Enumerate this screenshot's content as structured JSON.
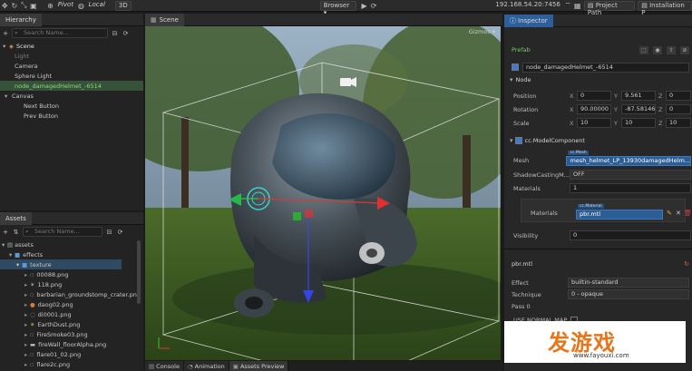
{
  "toolbar": {
    "pivot": "Pivot",
    "local": "Local",
    "mode_3d": "3D",
    "browser": "Browser",
    "ip": "192.168.54.20:7456",
    "project_path": "Project Path",
    "installation_path": "Installation P"
  },
  "hierarchy": {
    "title": "Hierarchy",
    "search_placeholder": "Search Name...",
    "items": [
      {
        "label": "Scene"
      },
      {
        "label": "Light"
      },
      {
        "label": "Camera"
      },
      {
        "label": "Sphere Light"
      },
      {
        "label": "node_damagedHelmet_-6514"
      },
      {
        "label": "Canvas"
      },
      {
        "label": "Next Button"
      },
      {
        "label": "Prev Button"
      }
    ]
  },
  "assets": {
    "title": "Assets",
    "search_placeholder": "Search Name...",
    "items": [
      {
        "label": "assets"
      },
      {
        "label": "effects"
      },
      {
        "label": "texture"
      },
      {
        "label": "00088.png"
      },
      {
        "label": "118.png"
      },
      {
        "label": "barbarian_groundstomp_crater.png"
      },
      {
        "label": "daog02.png"
      },
      {
        "label": "di0001.png"
      },
      {
        "label": "EarthDust.png"
      },
      {
        "label": "FireSmoke03.png"
      },
      {
        "label": "fireWall_floorAlpha.png"
      },
      {
        "label": "flare01_02.png"
      },
      {
        "label": "flare2c.png"
      }
    ]
  },
  "scene": {
    "title": "Scene",
    "gizmos": "Gizmos"
  },
  "bottom_tabs": [
    "Console",
    "Animation",
    "Assets Preview"
  ],
  "inspector": {
    "title": "Inspector",
    "prefab": "Prefab",
    "node_name": "node_damagedHelmet_-6514",
    "node_section": "Node",
    "position": {
      "label": "Position",
      "x": "0",
      "y": "9.561",
      "z": "0"
    },
    "rotation": {
      "label": "Rotation",
      "x": "90.00000",
      "y": "-87.58146",
      "z": "0"
    },
    "scale": {
      "label": "Scale",
      "x": "10",
      "y": "10",
      "z": "10"
    },
    "component": "cc.ModelComponent",
    "mesh_label": "Mesh",
    "mesh_tag": "cc.Mesh",
    "mesh_value": "mesh_helmet_LP_13930damagedHelm...",
    "shadow_label": "ShadowCastingM...",
    "shadow_value": "OFF",
    "materials_label": "Materials",
    "materials_count": "1",
    "materials_sub_label": "Materials",
    "material_tag": "cc.Material",
    "material_value": "pbr.mtl",
    "visibility_label": "Visibility",
    "visibility_value": "0",
    "material_file": "pbr.mtl",
    "effect_label": "Effect",
    "effect_value": "builtin-standard",
    "technique_label": "Technique",
    "technique_value": "0 - opaque",
    "pass_label": "Pass 0",
    "use_normal_map": "USE NORMAL MAP"
  },
  "watermark": {
    "brand": "发游戏",
    "url": "www.fayouxi.com"
  },
  "colors": {
    "accent_blue": "#3a7bd5",
    "selected_green": "#365238",
    "prefab_green": "#7bc96f"
  }
}
